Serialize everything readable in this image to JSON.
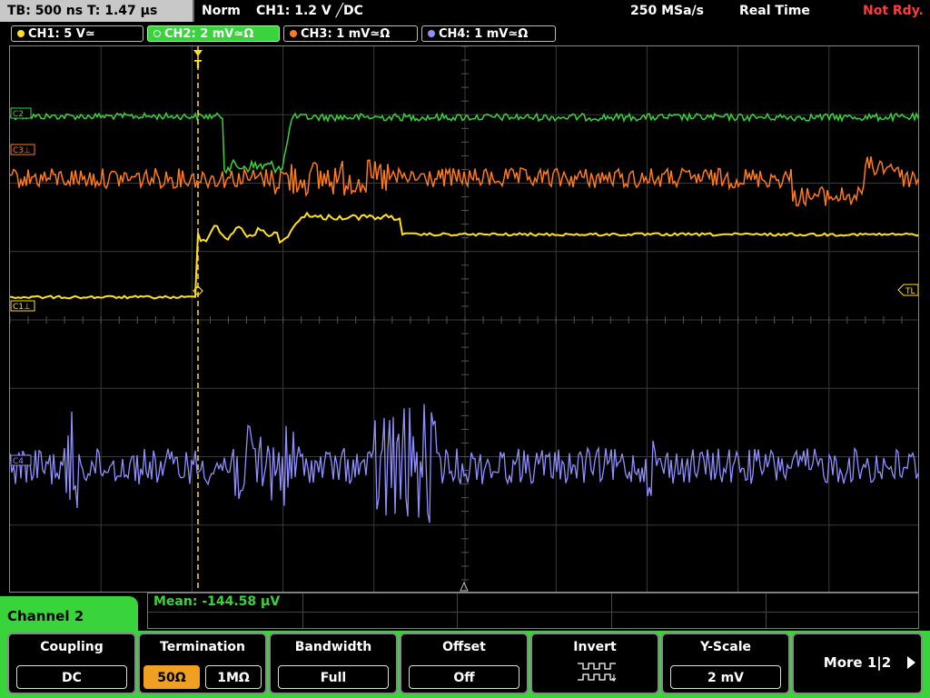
{
  "status": {
    "timebase": "TB: 500 ns   T: 1.47 µs",
    "trigger_mode": "Norm",
    "trigger_source": "CH1: 1.2 V ╱DC",
    "sample_rate": "250 MSa/s",
    "acq_mode": "Real Time",
    "state": "Not Rdy."
  },
  "channels": [
    {
      "label": "CH1: 5 V≃",
      "color": "#ffe01a"
    },
    {
      "label": "CH2: 2 mV≃Ω",
      "color": "#39d43c"
    },
    {
      "label": "CH3: 1 mV≃Ω",
      "color": "#ff7a1a"
    },
    {
      "label": "CH4: 1 mV≃Ω",
      "color": "#8f8fff"
    }
  ],
  "markers": {
    "c2": "C2",
    "c3": "C3⊥",
    "c1": "C1⊥",
    "c4": "C4",
    "trigger_level": "TL",
    "trigger_pos": "T"
  },
  "measurement": {
    "text": "Mean: -144.58 µV"
  },
  "menu": {
    "title": "Channel 2"
  },
  "softkeys": {
    "coupling": {
      "title": "Coupling",
      "value": "DC"
    },
    "termination": {
      "title": "Termination",
      "opt1": "50Ω",
      "opt2": "1MΩ",
      "selected": "50Ω"
    },
    "bandwidth": {
      "title": "Bandwidth",
      "value": "Full"
    },
    "offset": {
      "title": "Offset",
      "value": "Off"
    },
    "invert": {
      "title": "Invert",
      "icon": "invert-waveform-icon"
    },
    "yscale": {
      "title": "Y-Scale",
      "value": "2 mV"
    },
    "more": {
      "label": "More 1|2"
    }
  }
}
